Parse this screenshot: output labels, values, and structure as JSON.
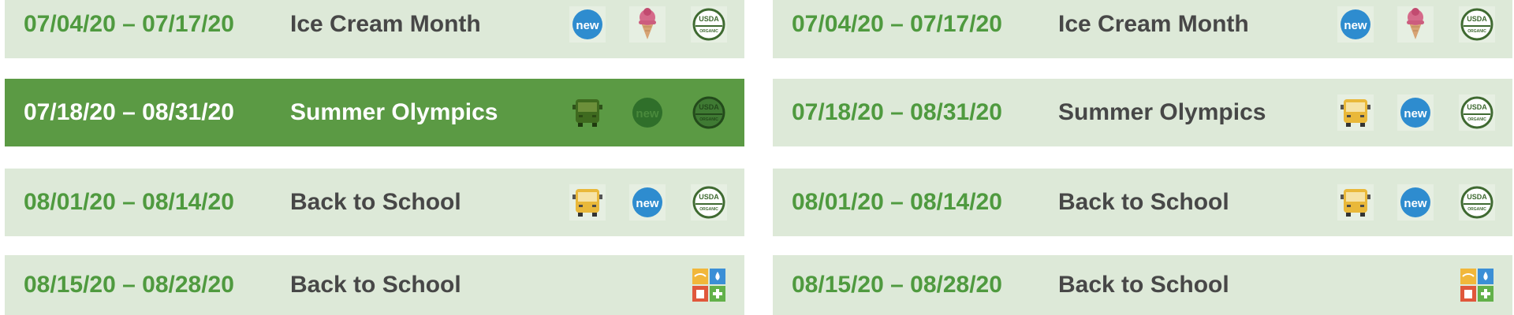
{
  "left_list": [
    {
      "dates": "07/04/20 – 07/17/20",
      "title": "Ice Cream Month",
      "selected": false,
      "icons": [
        "new-badge-icon",
        "ice-cream-icon",
        "usda-organic-icon"
      ]
    },
    {
      "dates": "07/18/20 – 08/31/20",
      "title": "Summer Olympics",
      "selected": true,
      "icons": [
        "school-bus-icon",
        "new-badge-icon",
        "usda-organic-icon"
      ]
    },
    {
      "dates": "08/01/20 – 08/14/20",
      "title": "Back to School",
      "selected": false,
      "icons": [
        "school-bus-icon",
        "new-badge-icon",
        "usda-organic-icon"
      ]
    },
    {
      "dates": "08/15/20 – 08/28/20",
      "title": "Back to School",
      "selected": false,
      "icons": [
        "allergen-grid-icon"
      ]
    }
  ],
  "right_list": [
    {
      "dates": "07/04/20 – 07/17/20",
      "title": "Ice Cream Month",
      "selected": false,
      "icons": [
        "new-badge-icon",
        "ice-cream-icon",
        "usda-organic-icon"
      ]
    },
    {
      "dates": "07/18/20 – 08/31/20",
      "title": "Summer Olympics",
      "selected": false,
      "icons": [
        "school-bus-icon",
        "new-badge-icon",
        "usda-organic-icon"
      ]
    },
    {
      "dates": "08/01/20 – 08/14/20",
      "title": "Back to School",
      "selected": false,
      "icons": [
        "school-bus-icon",
        "new-badge-icon",
        "usda-organic-icon"
      ]
    },
    {
      "dates": "08/15/20 – 08/28/20",
      "title": "Back to School",
      "selected": false,
      "icons": [
        "allergen-grid-icon"
      ]
    }
  ],
  "badges": {
    "new_text": "new",
    "organic_top": "USDA",
    "organic_bottom": "ORGANIC"
  },
  "colors": {
    "row_bg": "#dde9d8",
    "selected_bg": "#5b9a44",
    "date_green": "#4f9a3f",
    "title_gray": "#474747",
    "new_blue": "#2e8ccf",
    "new_dark": "#2f6f2a"
  }
}
